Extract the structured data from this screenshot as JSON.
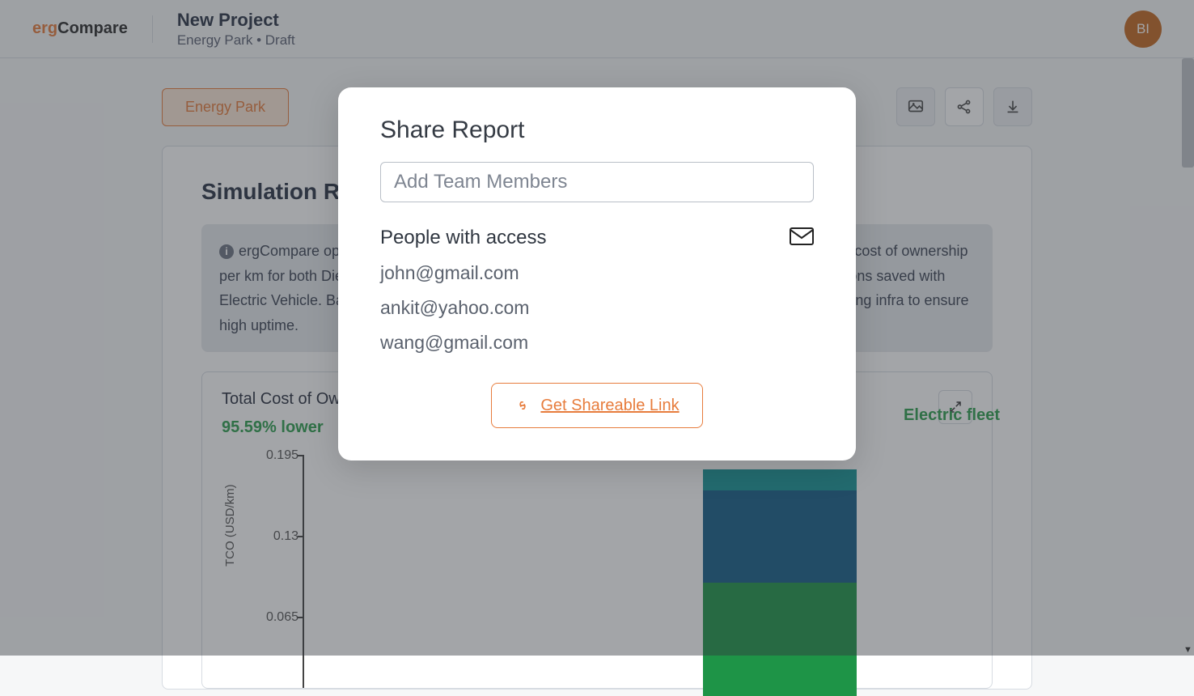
{
  "brand": {
    "prefix": "erg",
    "suffix": "Compare"
  },
  "project": {
    "title": "New Project",
    "context": "Energy Park",
    "status": "Draft"
  },
  "avatar": "BI",
  "tab_label": "Energy Park",
  "section_title": "Simulation Results",
  "info_box": "ergCompare optimized the charging strategy for your Electric Vehicle fleet, determined the total cost of ownership per km for both Diesel and Electric Vehicle vehicles, and has estimated the amount of CO2 emissions saved with Electric Vehicle. Based on existing public charging infrastructure and usage, we recommend charging infra to ensure high uptime.",
  "chart": {
    "title": "Total Cost of Ownership",
    "subtitle": "95.59% lower",
    "side_note": "Electric fleet",
    "ylabel": "TCO (USD/km)"
  },
  "chart_data": {
    "type": "bar",
    "title": "Total Cost of Ownership",
    "ylabel": "TCO (USD/km)",
    "ylim": [
      0,
      0.195
    ],
    "y_ticks": [
      0.195,
      0.13,
      0.065
    ],
    "categories": [
      "Electric fleet"
    ],
    "series": [
      {
        "name": "segment-teal",
        "color": "#179598",
        "values": [
          0.008
        ]
      },
      {
        "name": "segment-blue",
        "color": "#155D87",
        "values": [
          0.057
        ]
      },
      {
        "name": "segment-green",
        "color": "#1E9447",
        "values": [
          0.085
        ]
      }
    ]
  },
  "modal": {
    "title": "Share Report",
    "placeholder": "Add Team Members",
    "section": "People with access",
    "people": [
      "john@gmail.com",
      "ankit@yahoo.com",
      "wang@gmail.com"
    ],
    "button": "Get Shareable Link"
  }
}
